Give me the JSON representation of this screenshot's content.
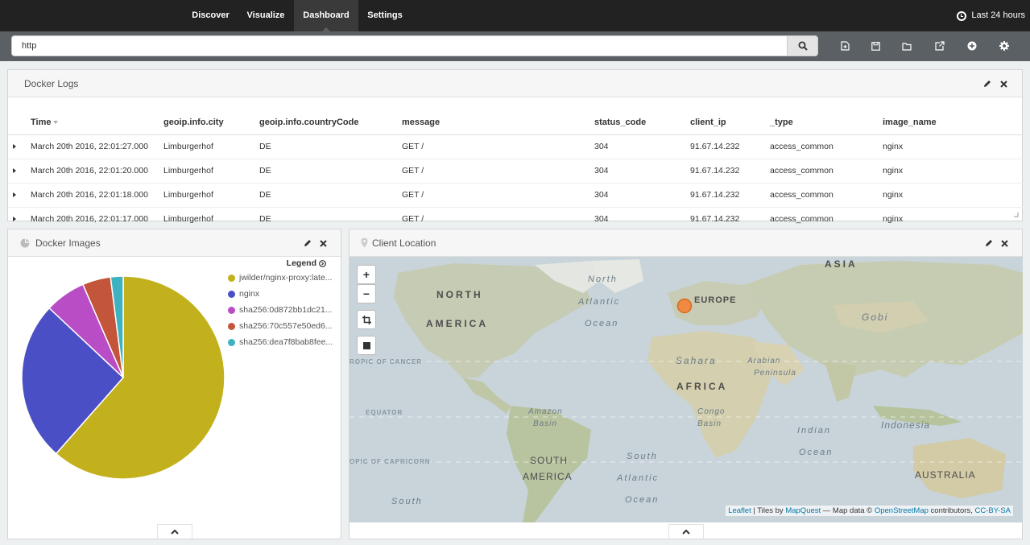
{
  "nav": {
    "tabs": [
      {
        "label": "Discover"
      },
      {
        "label": "Visualize"
      },
      {
        "label": "Dashboard"
      },
      {
        "label": "Settings"
      }
    ],
    "active_tab": "Dashboard",
    "time_range": "Last 24 hours"
  },
  "search": {
    "query": "http"
  },
  "toolbar": {
    "icons": [
      "new-dashboard-icon",
      "save-icon",
      "open-icon",
      "share-icon",
      "add-panel-icon",
      "settings-icon"
    ]
  },
  "docker_logs": {
    "title": "Docker Logs",
    "columns": [
      "Time",
      "geoip.info.city",
      "geoip.info.countryCode",
      "message",
      "status_code",
      "client_ip",
      "_type",
      "image_name"
    ],
    "rows": [
      [
        "March 20th 2016, 22:01:27.000",
        "Limburgerhof",
        "DE",
        "GET /",
        "304",
        "91.67.14.232",
        "access_common",
        "nginx"
      ],
      [
        "March 20th 2016, 22:01:20.000",
        "Limburgerhof",
        "DE",
        "GET /",
        "304",
        "91.67.14.232",
        "access_common",
        "nginx"
      ],
      [
        "March 20th 2016, 22:01:18.000",
        "Limburgerhof",
        "DE",
        "GET /",
        "304",
        "91.67.14.232",
        "access_common",
        "nginx"
      ],
      [
        "March 20th 2016, 22:01:17.000",
        "Limburgerhof",
        "DE",
        "GET /",
        "304",
        "91.67.14.232",
        "access_common",
        "nginx"
      ]
    ]
  },
  "docker_images": {
    "title": "Docker Images",
    "legend_title": "Legend",
    "legend": [
      {
        "label": "jwilder/nginx-proxy:late...",
        "color": "#c2b11d"
      },
      {
        "label": "nginx",
        "color": "#4b4fc5"
      },
      {
        "label": "sha256:0d872bb1dc21...",
        "color": "#b94dc6"
      },
      {
        "label": "sha256:70c557e50ed6...",
        "color": "#c2553a"
      },
      {
        "label": "sha256:dea7f8bab8fee...",
        "color": "#3fb2c2"
      }
    ]
  },
  "chart_data": {
    "type": "pie",
    "categories": [
      "jwilder/nginx-proxy:late...",
      "nginx",
      "sha256:0d872bb1dc21...",
      "sha256:70c557e50ed6...",
      "sha256:dea7f8bab8fee..."
    ],
    "values": [
      61.5,
      25.5,
      6.5,
      4.5,
      2.0
    ],
    "legend": "top-right"
  },
  "client_location": {
    "title": "Client Location",
    "zoom_in": "+",
    "zoom_out": "−",
    "labels": {
      "asia": "ASIA",
      "north": "NORTH",
      "america": "AMERICA",
      "europe": "EUROPE",
      "gobi": "Gobi",
      "sahara": "Sahara",
      "arabian": "Arabian",
      "peninsula": "Peninsula",
      "africa": "AFRICA",
      "amazon": "Amazon",
      "basin": "Basin",
      "congo": "Congo",
      "congo_basin": "Basin",
      "indonesia": "Indonesia",
      "south": "SOUTH",
      "south_america": "AMERICA",
      "australia": "AUSTRALIA",
      "tropic_cancer": "ROPIC OF CANCER",
      "equator": "EQUATOR",
      "tropic_capricorn": "OPIC OF CAPRICORN",
      "north_atlantic_1": "North",
      "north_atlantic_2": "Atlantic",
      "north_atlantic_3": "Ocean",
      "south_atlantic_1": "South",
      "south_atlantic_2": "Atlantic",
      "south_atlantic_3": "Ocean",
      "indian_1": "Indian",
      "indian_2": "Ocean",
      "south_pacific": "South"
    },
    "attribution": {
      "leaflet": "Leaflet",
      "tiles_by": " | Tiles by ",
      "mapquest": "MapQuest",
      "map_data": " — Map data © ",
      "osm": "OpenStreetMap",
      "contributors": " contributors, ",
      "license": "CC-BY-SA"
    },
    "marker_color": "#f08a43"
  }
}
